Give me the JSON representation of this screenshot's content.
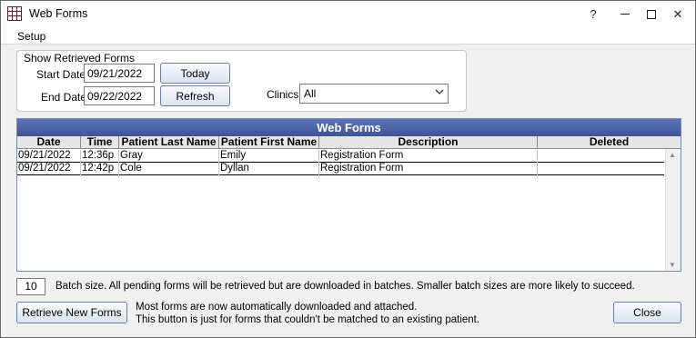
{
  "window": {
    "title": "Web Forms",
    "help": "?",
    "close_glyph": "✕"
  },
  "menu": {
    "setup": "Setup"
  },
  "filters": {
    "group_title": "Show Retrieved Forms",
    "start_label": "Start Date",
    "start_value": "09/21/2022",
    "end_label": "End Date",
    "end_value": "09/22/2022",
    "today_button": "Today",
    "refresh_button": "Refresh",
    "clinics_label": "Clinics",
    "clinics_value": "All"
  },
  "grid": {
    "title": "Web Forms",
    "columns": [
      "Date",
      "Time",
      "Patient Last Name",
      "Patient First Name",
      "Description",
      "Deleted"
    ],
    "rows": [
      [
        "09/21/2022",
        "12:36p",
        "Gray",
        "Emily",
        "Registration Form",
        ""
      ],
      [
        "09/21/2022",
        "12:42p",
        "Cole",
        "Dyllan",
        "Registration Form",
        ""
      ]
    ]
  },
  "batch": {
    "size": "10",
    "note": "Batch size. All pending forms will be retrieved but are downloaded in batches. Smaller batch sizes are more likely to succeed."
  },
  "actions": {
    "retrieve_button": "Retrieve New Forms",
    "retrieve_note_1": "Most forms are now automatically downloaded and attached.",
    "retrieve_note_2": "This button is just for forms that couldn't be matched to an existing patient.",
    "close_button": "Close"
  },
  "colors": {
    "grid_title_bg": "#4a63a8",
    "app_icon": "#6b1d2b"
  }
}
